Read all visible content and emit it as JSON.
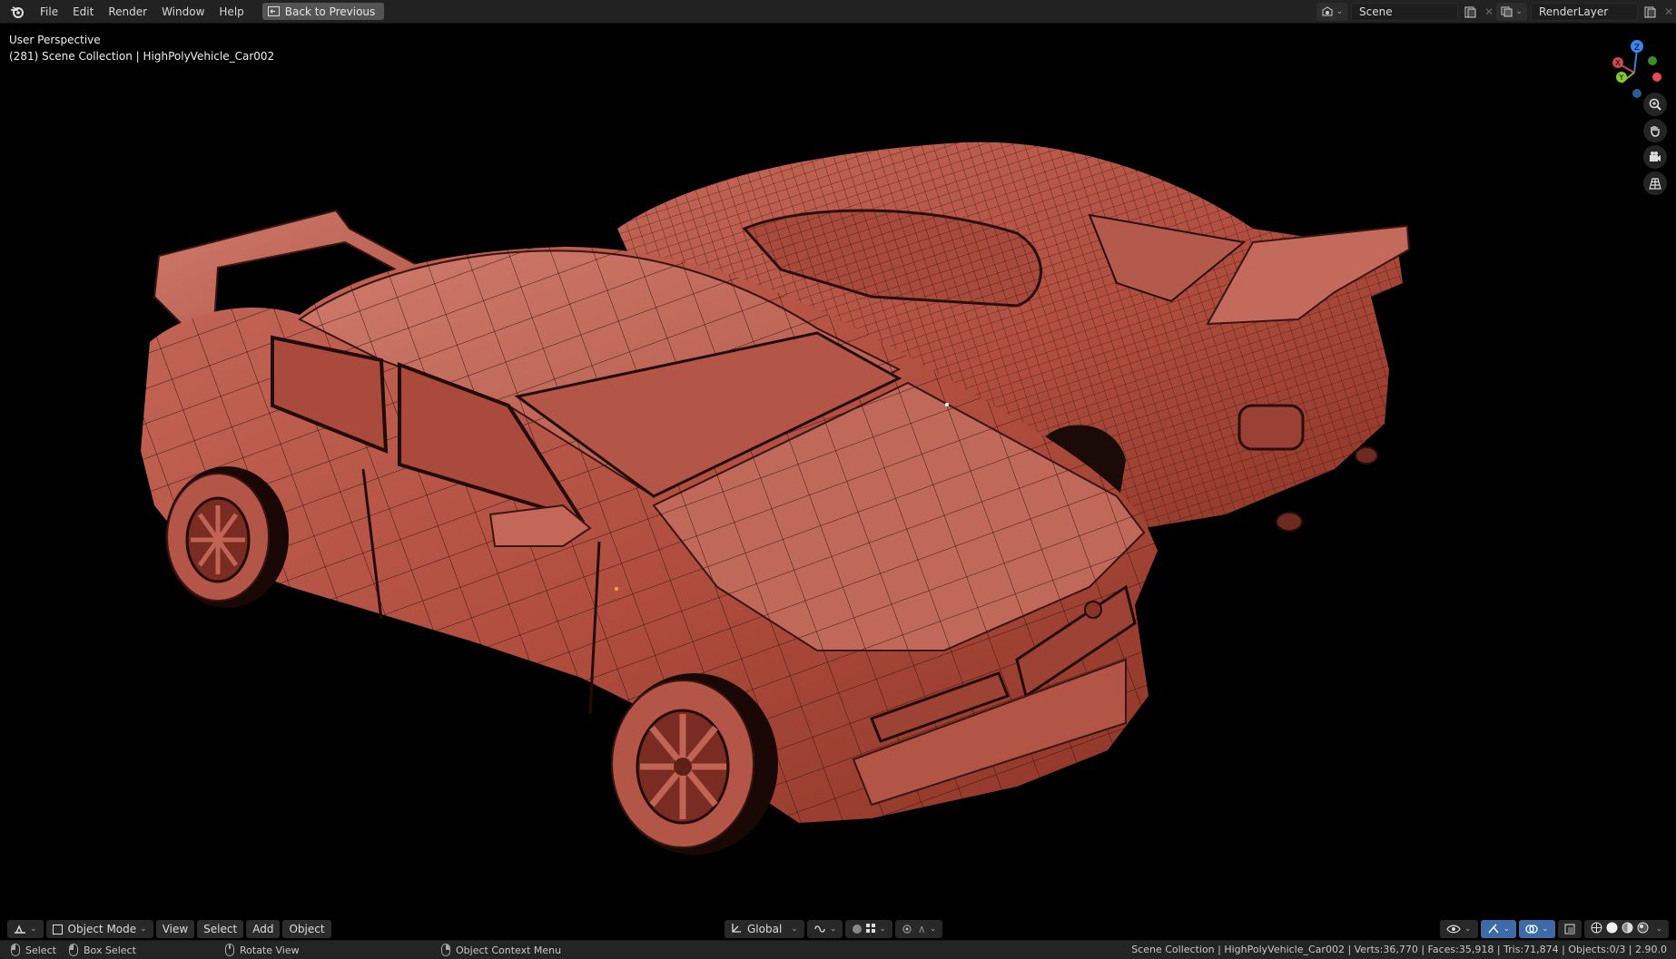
{
  "menu": {
    "items": [
      "File",
      "Edit",
      "Render",
      "Window",
      "Help"
    ],
    "back_label": "Back to Previous"
  },
  "scene": {
    "scene_name": "Scene",
    "render_layer": "RenderLayer"
  },
  "viewport": {
    "perspective": "User Perspective",
    "collection_path": "(281) Scene Collection | HighPolyVehicle_Car002",
    "gizmo_axes": [
      "Z",
      "X",
      "Y"
    ],
    "colors": {
      "background": "#000000",
      "mesh": "#b8574a",
      "wire": "#3a1512"
    }
  },
  "header": {
    "mode": "Object Mode",
    "menus": [
      "View",
      "Select",
      "Add",
      "Object"
    ],
    "orientation": "Global"
  },
  "status": {
    "select": "Select",
    "box_select": "Box Select",
    "rotate_view": "Rotate View",
    "context_menu": "Object Context Menu",
    "stats": "Scene Collection | HighPolyVehicle_Car002 | Verts:36,770 | Faces:35,918 | Tris:71,874 | Objects:0/3 | 2.90.0"
  },
  "icons": [
    "blender-logo-icon",
    "back-icon",
    "scene-icon",
    "new-scene-icon",
    "close-icon",
    "render-layer-icon",
    "zoom-icon",
    "hand-icon",
    "camera-icon",
    "grid-icon",
    "editor-type-icon",
    "object-mode-icon",
    "orientation-icon",
    "pivot-icon",
    "snap-icon",
    "proportional-icon",
    "visibility-icon",
    "gizmo-icon",
    "overlay-icon",
    "xray-icon",
    "shading-wire-icon",
    "shading-solid-icon",
    "shading-material-icon",
    "shading-render-icon"
  ]
}
